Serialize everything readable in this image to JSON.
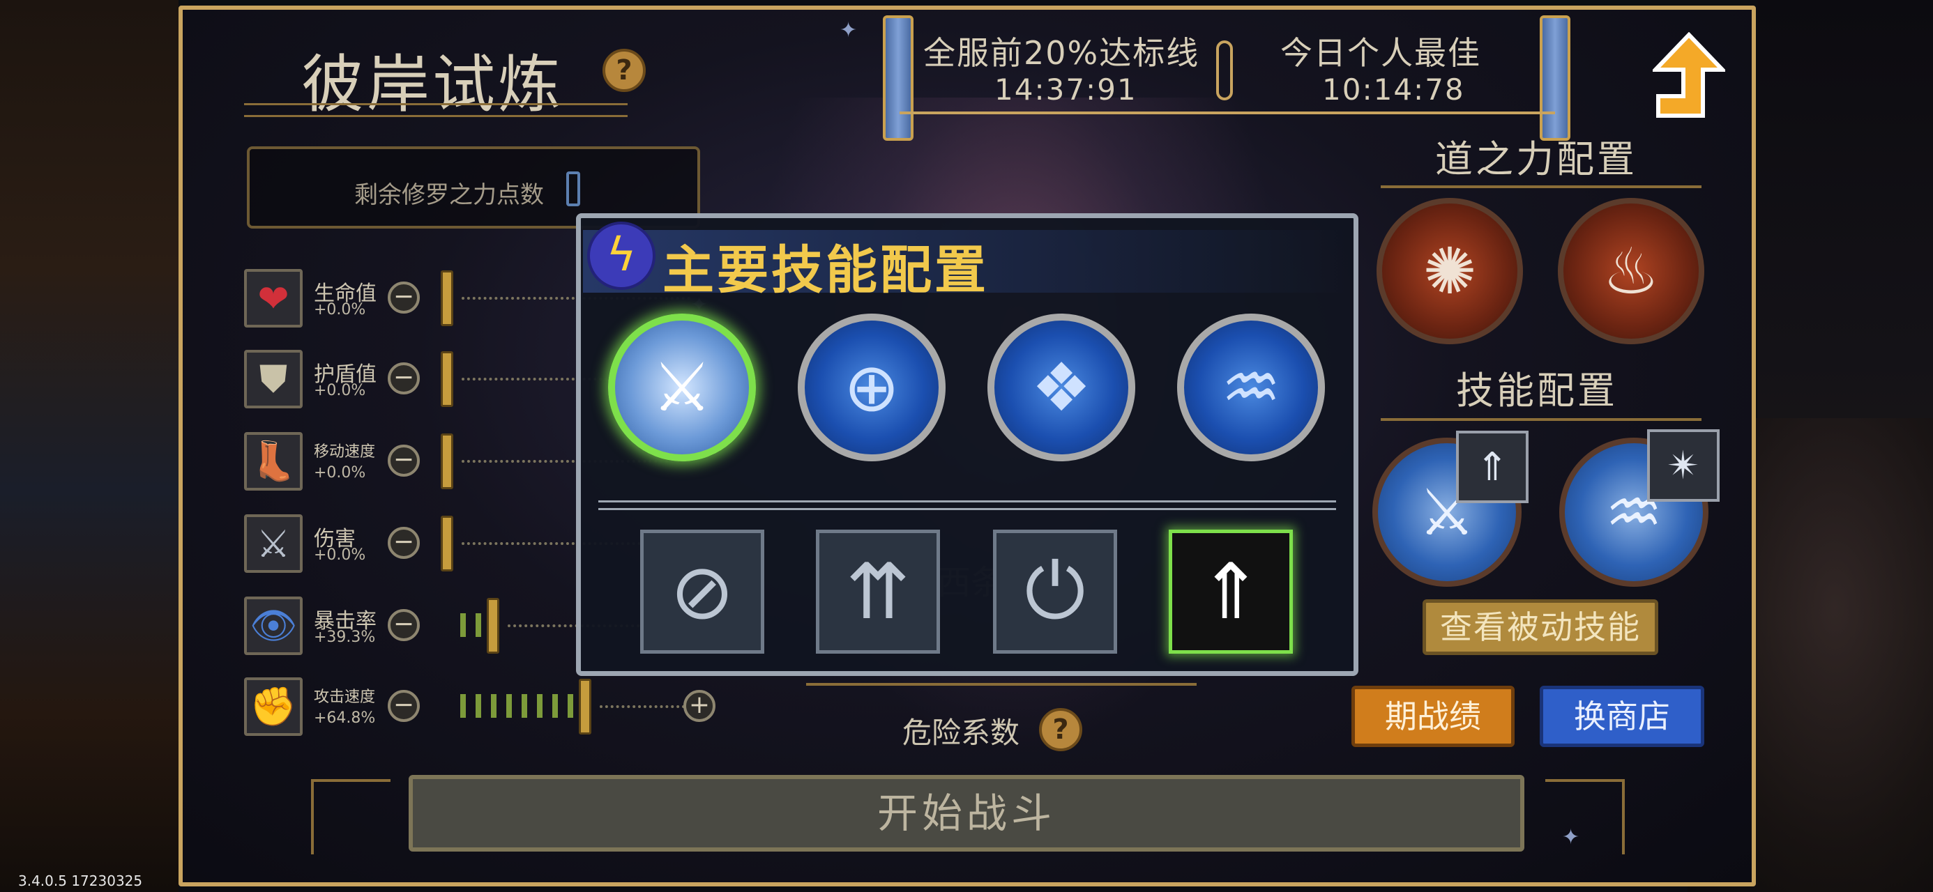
{
  "header": {
    "title": "彼岸试炼",
    "help_icon": "?",
    "remaining_points_label": "剩余修罗之力点数"
  },
  "timers": {
    "server_top_label": "全服前20%达标线",
    "server_top_value": "14:37:91",
    "personal_best_label": "今日个人最佳",
    "personal_best_value": "10:14:78"
  },
  "stats": [
    {
      "name": "生命值",
      "value": "+0.0%",
      "icon": "heart-icon",
      "fill_level": 0
    },
    {
      "name": "护盾值",
      "value": "+0.0%",
      "icon": "shield-icon",
      "fill_level": 0
    },
    {
      "name": "移动速度",
      "value": "+0.0%",
      "icon": "boot-icon",
      "fill_level": 0
    },
    {
      "name": "伤害",
      "value": "+0.0%",
      "icon": "sword-icon",
      "fill_level": 0
    },
    {
      "name": "暴击率",
      "value": "+39.3%",
      "icon": "eye-icon",
      "fill_level": 3
    },
    {
      "name": "攻击速度",
      "value": "+64.8%",
      "icon": "fist-icon",
      "fill_level": 9
    }
  ],
  "right_panel": {
    "dao_config_title": "道之力配置",
    "skill_config_title": "技能配置",
    "passive_button": "查看被动技能",
    "season_record_button": "期战绩",
    "exchange_shop_button": "换商店"
  },
  "center": {
    "danger_label": "危险系数",
    "danger_help": "?",
    "start_button": "开始战斗",
    "behind_text": "西条"
  },
  "modal": {
    "title": "主要技能配置",
    "skills": [
      {
        "icon": "sword-skill-icon",
        "selected": true
      },
      {
        "icon": "crosshair-skill-icon",
        "selected": false
      },
      {
        "icon": "crack-skill-icon",
        "selected": false
      },
      {
        "icon": "flame-skill-icon",
        "selected": false
      }
    ],
    "options": [
      {
        "icon": "no-icon",
        "selected": false
      },
      {
        "icon": "energy-arrows-icon",
        "selected": false
      },
      {
        "icon": "cooldown-icon",
        "selected": false
      },
      {
        "icon": "ground-arrows-icon",
        "selected": true
      }
    ]
  },
  "version": "3.4.0.5 17230325",
  "colors": {
    "panel_border": "#c9a45f",
    "modal_title": "#f2c94c",
    "selection": "#7ee04b",
    "skill_blue": "#1b4fb0",
    "dao_red": "#6b2412"
  }
}
